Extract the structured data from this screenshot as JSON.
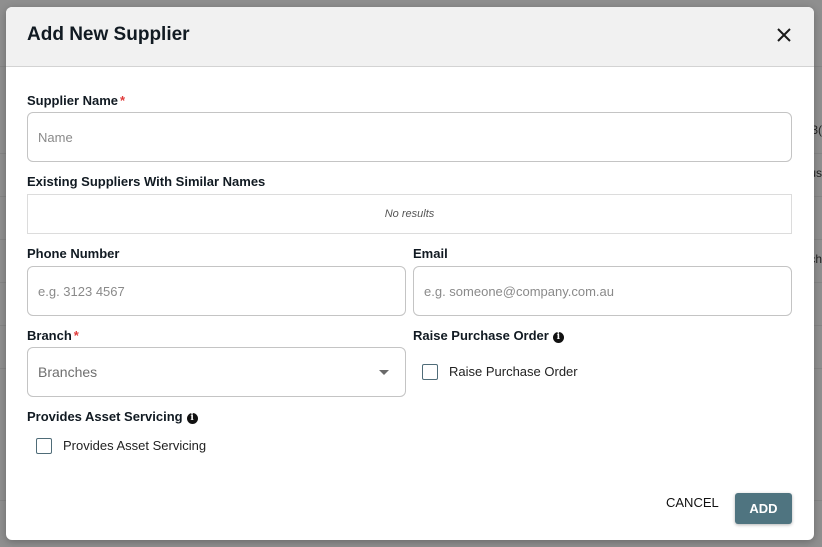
{
  "background": {
    "partial_texts": [
      "3(",
      "us",
      "ch"
    ]
  },
  "dialog": {
    "title": "Add New Supplier",
    "close_icon": "close-icon",
    "supplier_name": {
      "label": "Supplier Name",
      "required_mark": "*",
      "value": "",
      "placeholder": "Name"
    },
    "similar_names": {
      "label": "Existing Suppliers With Similar Names",
      "empty_text": "No results"
    },
    "phone": {
      "label": "Phone Number",
      "value": "",
      "placeholder": "e.g. 3123 4567"
    },
    "email": {
      "label": "Email",
      "value": "",
      "placeholder": "e.g. someone@company.com.au"
    },
    "branch": {
      "label": "Branch",
      "required_mark": "*",
      "selected": "Branches"
    },
    "raise_po": {
      "label": "Raise Purchase Order",
      "info_icon": "info-icon",
      "checkbox_label": "Raise Purchase Order",
      "checked": false
    },
    "asset_servicing": {
      "label": "Provides Asset Servicing",
      "info_icon": "info-icon",
      "checkbox_label": "Provides Asset Servicing",
      "checked": false
    },
    "actions": {
      "cancel_label": "CANCEL",
      "add_label": "ADD"
    },
    "colors": {
      "primary": "#4f7480",
      "required": "#e03b3b",
      "header_bg": "#f1f1f1"
    }
  }
}
